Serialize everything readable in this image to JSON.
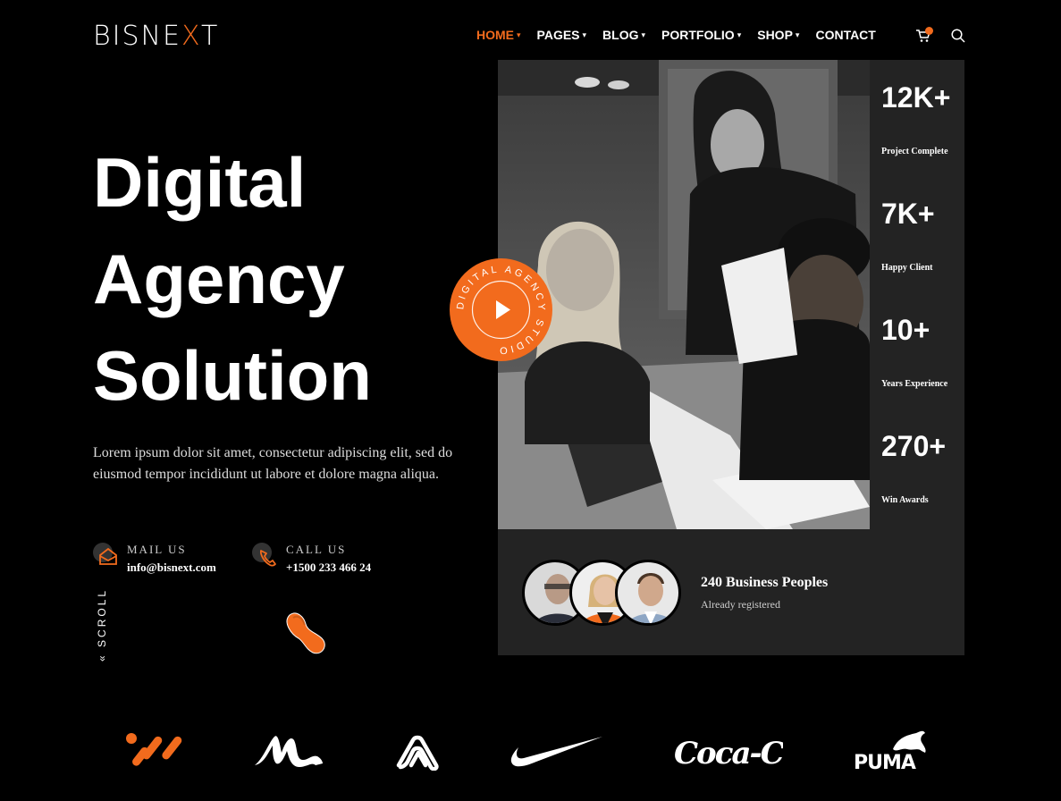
{
  "header": {
    "logo": "BISNEXT",
    "nav": [
      {
        "label": "HOME",
        "dropdown": true,
        "active": true
      },
      {
        "label": "PAGES",
        "dropdown": true
      },
      {
        "label": "BLOG",
        "dropdown": true
      },
      {
        "label": "PORTFOLIO",
        "dropdown": true
      },
      {
        "label": "SHOP",
        "dropdown": true
      },
      {
        "label": "CONTACT",
        "dropdown": false
      }
    ],
    "icons": [
      "cart-icon",
      "search-icon"
    ]
  },
  "hero": {
    "title_lines": [
      "Digital",
      "Agency",
      "Solution"
    ],
    "description": "Lorem ipsum dolor sit amet, consectetur adipiscing elit, sed do eiusmod tempor incididunt ut labore et dolore magna aliqua.",
    "mail": {
      "label": "MAIL US",
      "value": "info@bisnext.com"
    },
    "call": {
      "label": "CALL US",
      "value": "+1500 233 466 24"
    },
    "scroll_label": "SCROLL"
  },
  "play_badge": {
    "ring_text": "DIGITAL AGENCY STUDIO"
  },
  "stats": [
    {
      "value": "12K+",
      "label": "Project Complete"
    },
    {
      "value": "7K+",
      "label": "Happy Client"
    },
    {
      "value": "10+",
      "label": "Years Experience"
    },
    {
      "value": "270+",
      "label": "Win Awards"
    }
  ],
  "business": {
    "title": "240 Business Peoples",
    "subtitle": "Already registered"
  },
  "brands": [
    "brand-logo-1",
    "brand-logo-2",
    "brand-logo-3",
    "nike",
    "Coca-Cola",
    "PUMA"
  ],
  "colors": {
    "accent": "#f26b1d",
    "panel": "#232323",
    "background": "#000000"
  }
}
